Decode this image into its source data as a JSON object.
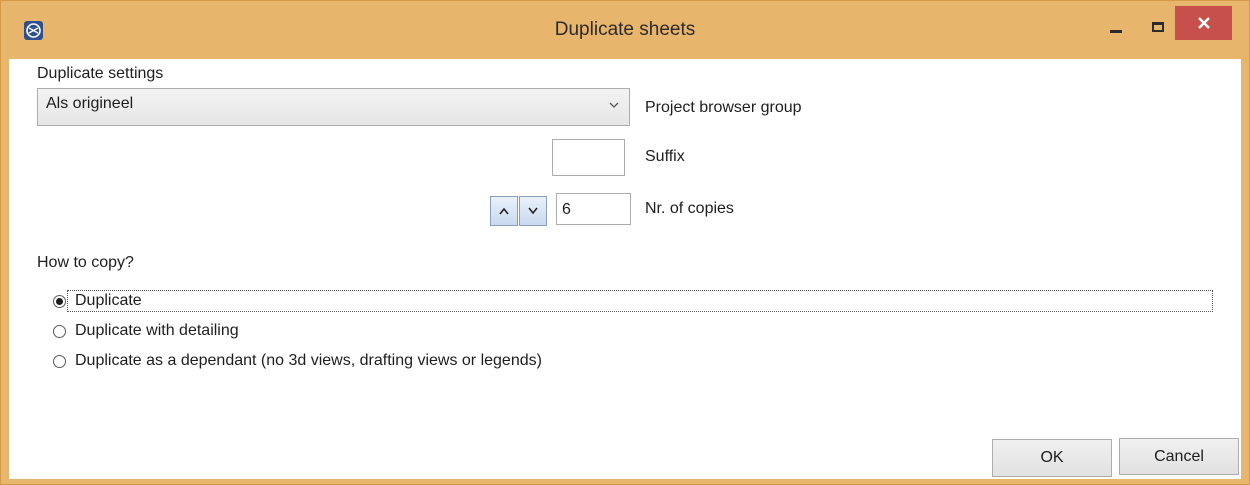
{
  "window": {
    "title": "Duplicate sheets",
    "accent_color": "#e8b56c",
    "close_color": "#c7504b",
    "controls": {
      "minimize": "minimize-icon",
      "maximize": "maximize-icon",
      "close": "close-icon"
    }
  },
  "settings": {
    "duplicate_settings_label": "Duplicate settings",
    "project_browser_group": {
      "selected_value": "Als origineel",
      "label": "Project browser group",
      "icon": "chevron-down-icon"
    },
    "suffix": {
      "label": "Suffix",
      "value": ""
    },
    "copies": {
      "label": "Nr. of copies",
      "value": "6",
      "up_label": "ʌ",
      "down_label": "v"
    }
  },
  "how_to_copy": {
    "label": "How to copy?",
    "options": [
      {
        "label": "Duplicate",
        "checked": true
      },
      {
        "label": "Duplicate with detailing",
        "checked": false
      },
      {
        "label": "Duplicate as a dependant (no 3d views, drafting views or legends)",
        "checked": false
      }
    ]
  },
  "buttons": {
    "ok": "OK",
    "cancel": "Cancel"
  }
}
